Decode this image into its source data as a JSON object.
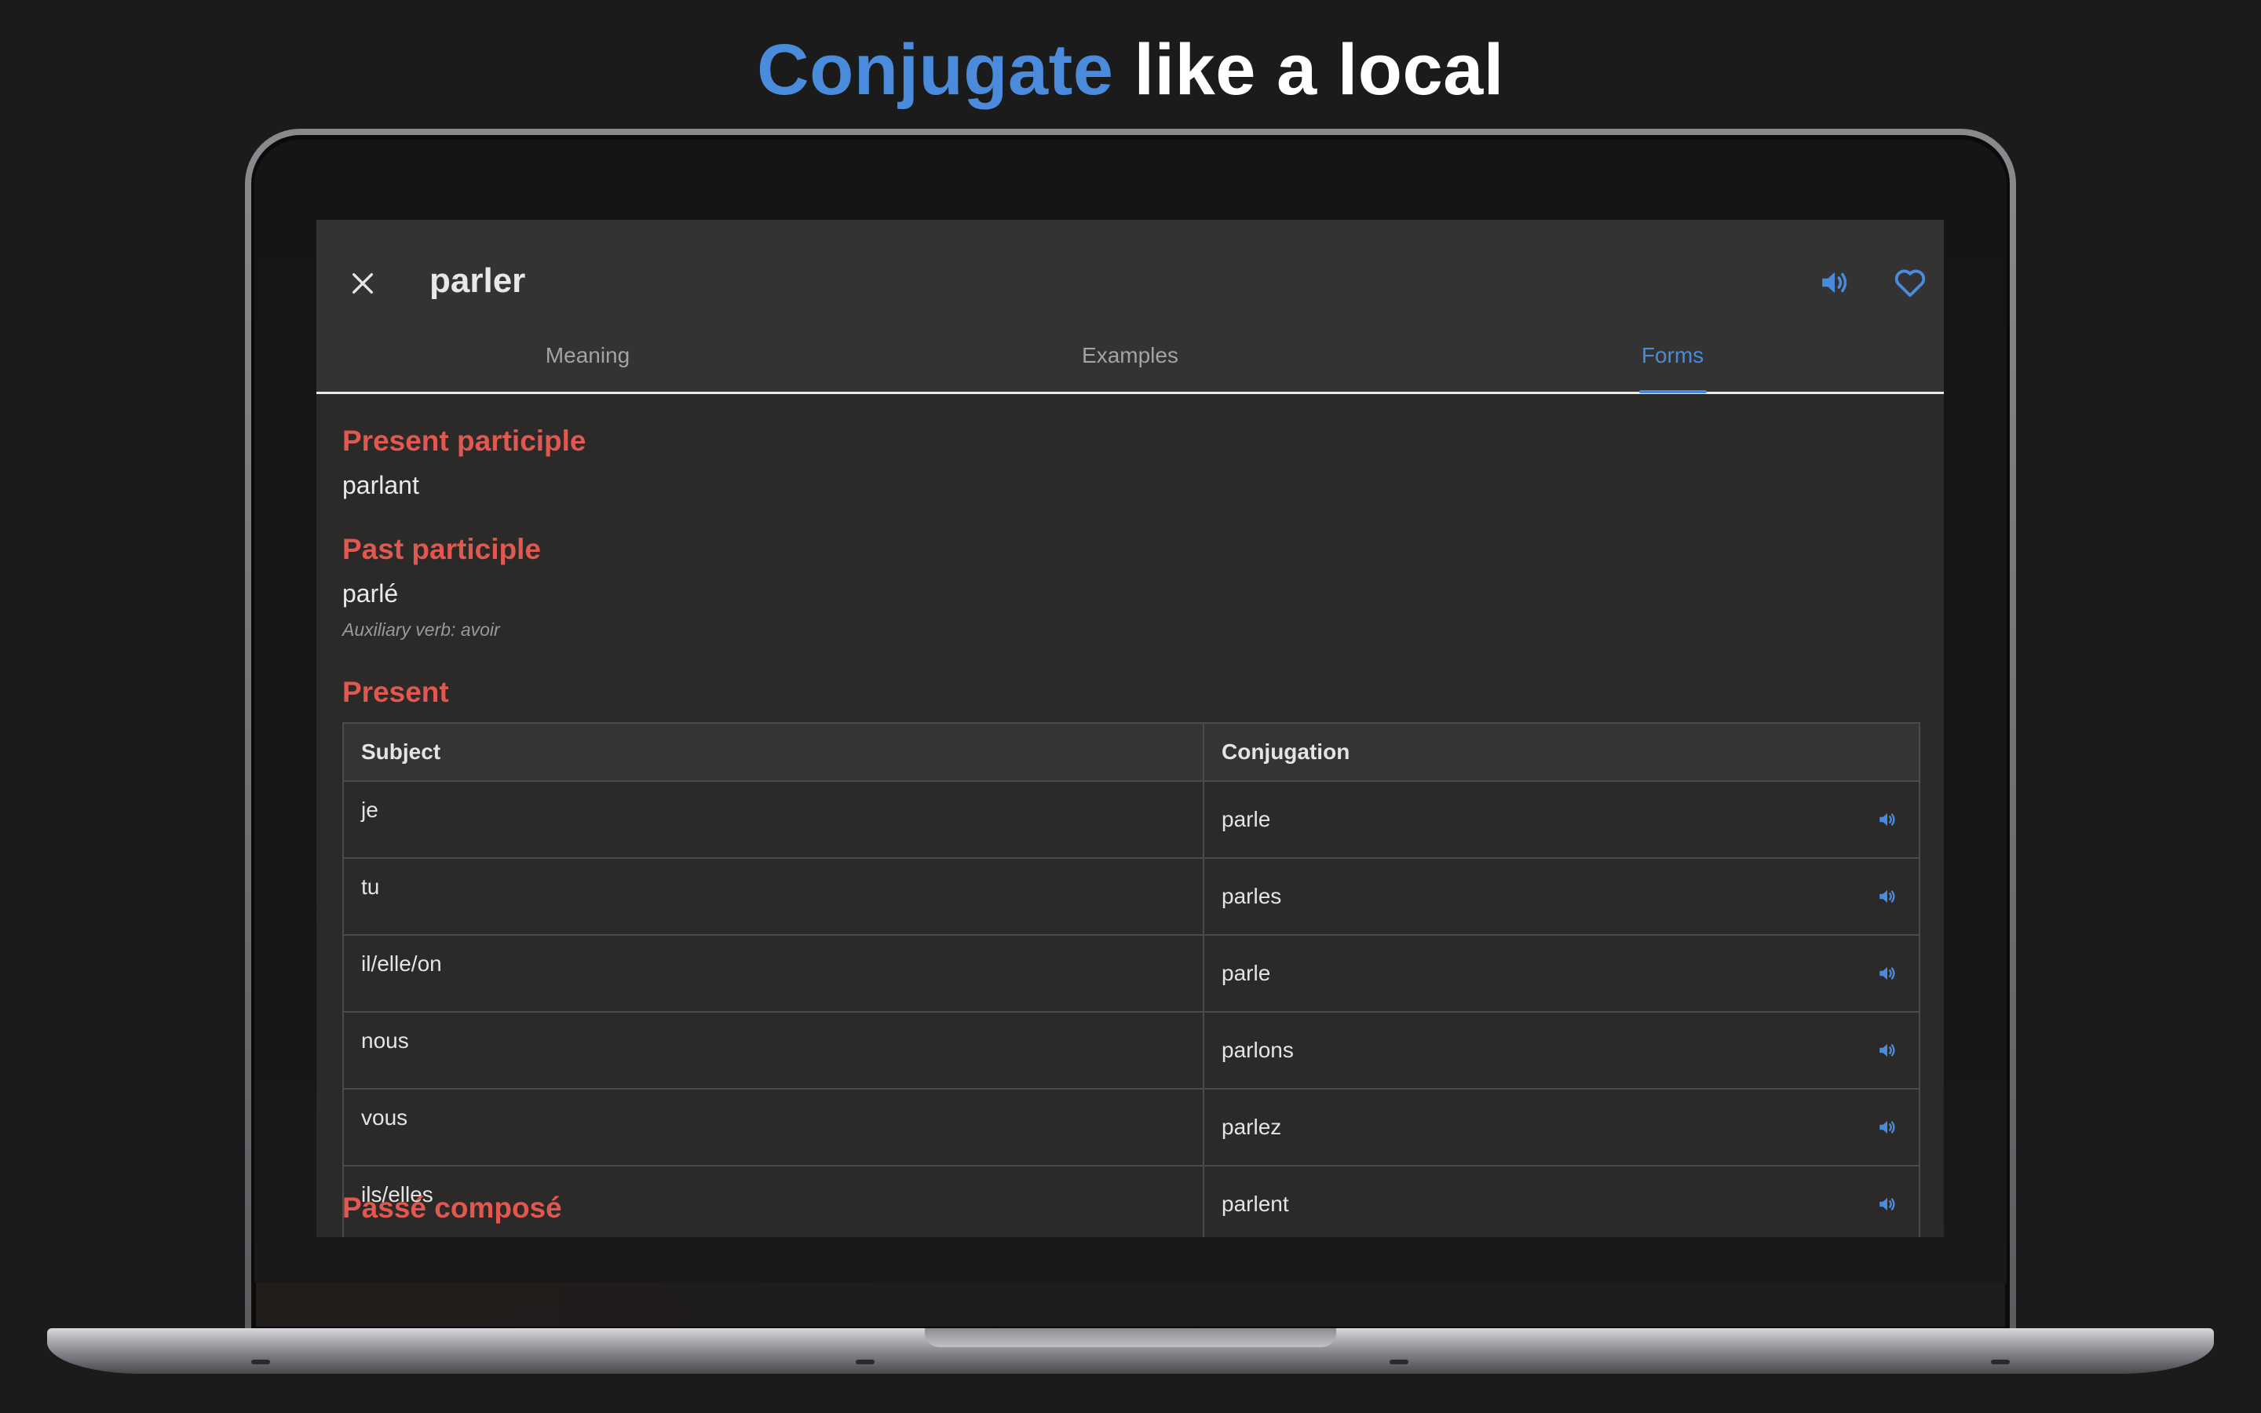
{
  "headline": {
    "accent": "Conjugate",
    "rest": " like a local"
  },
  "colors": {
    "accent": "#4a8bdc",
    "section": "#e0584f",
    "background": "#1c1b1b"
  },
  "app": {
    "title": "parler",
    "icons": {
      "close": "close-icon",
      "speaker": "speaker-icon",
      "favorite": "heart-icon"
    },
    "tabs": [
      {
        "label": "Meaning",
        "active": false
      },
      {
        "label": "Examples",
        "active": false
      },
      {
        "label": "Forms",
        "active": true
      }
    ]
  },
  "forms": {
    "present_participle": {
      "heading": "Present participle",
      "value": "parlant"
    },
    "past_participle": {
      "heading": "Past participle",
      "value": "parlé",
      "note": "Auxiliary verb: avoir"
    },
    "present": {
      "heading": "Present",
      "columns": [
        "Subject",
        "Conjugation"
      ],
      "rows": [
        {
          "subject": "je",
          "conjugation": "parle"
        },
        {
          "subject": "tu",
          "conjugation": "parles"
        },
        {
          "subject": "il/elle/on",
          "conjugation": "parle"
        },
        {
          "subject": "nous",
          "conjugation": "parlons"
        },
        {
          "subject": "vous",
          "conjugation": "parlez"
        },
        {
          "subject": "ils/elles",
          "conjugation": "parlent"
        }
      ]
    },
    "next_section": {
      "heading": "Passé composé"
    }
  }
}
